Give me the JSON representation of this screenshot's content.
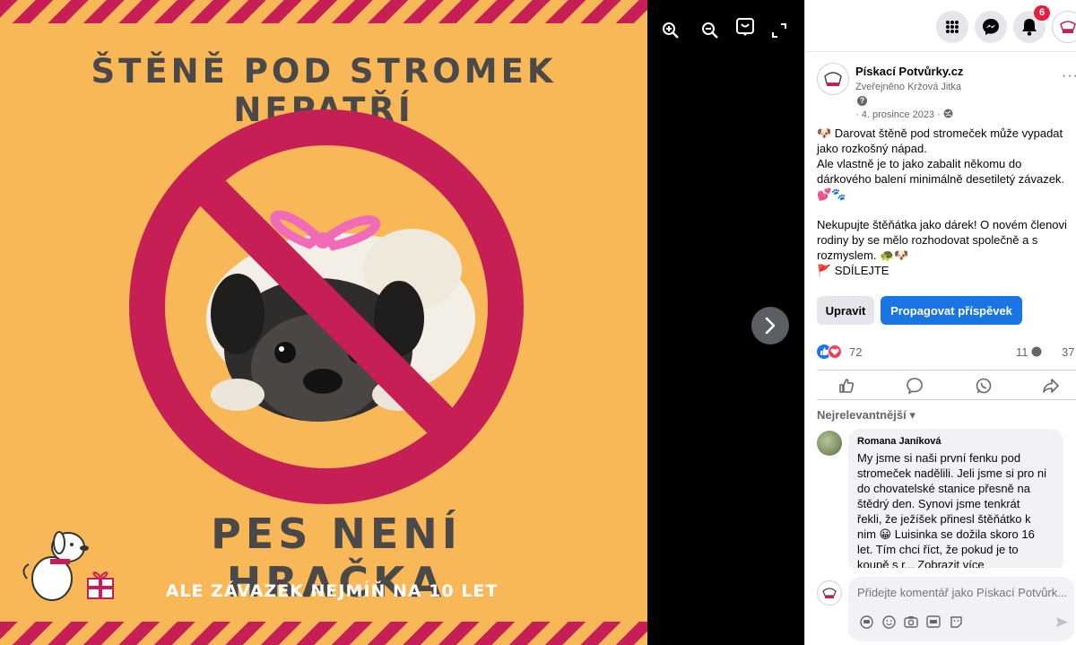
{
  "image": {
    "headline": "ŠTĚNĚ POD STROMEK NEPATŘÍ",
    "subhead": "PES NENÍ HRAČKA",
    "tagline": "ALE ZÁVAZEK NEJMÍŇ NA 10 LET",
    "colors": {
      "background": "#f9b857",
      "accent": "#c61f55",
      "text": "#4a4848"
    }
  },
  "viewer": {
    "icons": [
      "zoom-in-icon",
      "zoom-out-icon",
      "tag-icon",
      "fullscreen-icon"
    ],
    "next_icon": "chevron-right-icon"
  },
  "topbar": {
    "icons": [
      "apps-grid-icon",
      "messenger-icon",
      "bell-icon",
      "profile-avatar"
    ],
    "notification_count": "6"
  },
  "post": {
    "page_name": "Pískací Potvůrky.cz",
    "published_by": "Zveřejněno Kržová Jitka",
    "date": "· 4. prosince 2023 ·",
    "more": "···",
    "body_lines": [
      "🐶 Darovat štěně pod stromeček může vypadat",
      "jako rozkošný nápad.",
      "Ale vlastně je to jako zabalit někomu do",
      "dárkového balení minimálně desetiletý závazek.",
      "💕🐾",
      "",
      "Nekupujte štěňátka jako dárek! O novém členovi",
      "rodiny by se mělo rozhodovat společně a s",
      "rozmyslem. 🐢🐶",
      "🚩 SDÍLEJTE"
    ],
    "edit_label": "Upravit",
    "promote_label": "Propagovat příspěvek",
    "reaction_count": "72",
    "comment_count": "11",
    "share_count": "37",
    "sort_label": "Nejrelevantnější ▾"
  },
  "comment": {
    "author": "Romana Janíková",
    "text_lines": [
      "My jsme si naši první fenku pod",
      "stromeček nadělili. Jeli jsme si pro ni",
      "do chovatelské stanice přesně na",
      "štědrý den. Synovi jsme tenkrát",
      "řekli, že ježíšek přinesl štěňátko k",
      "nim 😀 Luisinka se dožila skoro 16",
      "let. Tím chci říct, že pokud je to",
      "koupě s r... Zobrazit více"
    ]
  },
  "composer": {
    "placeholder": "Přidejte komentář jako Pískací Potvůrk...",
    "icons": [
      "avatar-sticker-icon",
      "emoji-icon",
      "camera-icon",
      "gif-icon",
      "sticker-icon",
      "send-icon"
    ]
  }
}
